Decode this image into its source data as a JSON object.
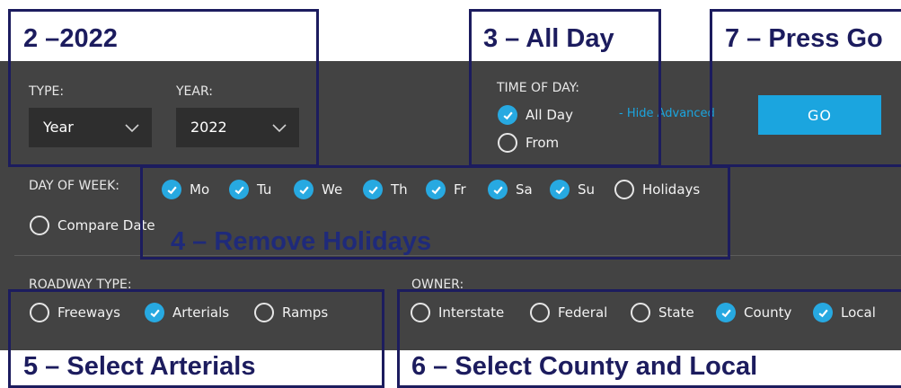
{
  "filters": {
    "type": {
      "label": "TYPE:",
      "value": "Year"
    },
    "year": {
      "label": "YEAR:",
      "value": "2022"
    },
    "time_of_day": {
      "label": "TIME OF DAY:",
      "options": [
        {
          "label": "All Day",
          "checked": true
        },
        {
          "label": "From",
          "checked": false
        }
      ]
    },
    "hide_advanced": "- Hide Advanced",
    "go": "GO",
    "day_of_week": {
      "label": "DAY OF WEEK:",
      "options": [
        {
          "label": "Mo",
          "checked": true
        },
        {
          "label": "Tu",
          "checked": true
        },
        {
          "label": "We",
          "checked": true
        },
        {
          "label": "Th",
          "checked": true
        },
        {
          "label": "Fr",
          "checked": true
        },
        {
          "label": "Sa",
          "checked": true
        },
        {
          "label": "Su",
          "checked": true
        },
        {
          "label": "Holidays",
          "checked": false
        }
      ],
      "compare_date": "Compare Date"
    },
    "roadway_type": {
      "label": "ROADWAY TYPE:",
      "options": [
        {
          "label": "Freeways",
          "checked": false
        },
        {
          "label": "Arterials",
          "checked": true
        },
        {
          "label": "Ramps",
          "checked": false
        }
      ]
    },
    "owner": {
      "label": "OWNER:",
      "options": [
        {
          "label": "Interstate",
          "checked": false
        },
        {
          "label": "Federal",
          "checked": false
        },
        {
          "label": "State",
          "checked": false
        },
        {
          "label": "County",
          "checked": true
        },
        {
          "label": "Local",
          "checked": true
        }
      ]
    }
  },
  "annotations": {
    "step2": "2 –2022",
    "step3": "3 – All Day",
    "step7": "7 – Press Go",
    "step4": "4 – Remove Holidays",
    "step5": "5 – Select Arterials",
    "step6": "6 – Select County and Local"
  },
  "colors": {
    "panel": "#434343",
    "accent": "#1ba5df",
    "annotation": "#1c1c5e"
  }
}
